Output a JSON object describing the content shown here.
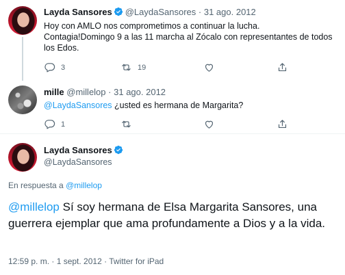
{
  "tweet1": {
    "name": "Layda Sansores",
    "handle": "@LaydaSansores",
    "sep": "·",
    "date": "31 ago. 2012",
    "text": "Hoy con AMLO nos comprometimos a continuar la lucha.\nContagia!Domingo 9 a las 11 marcha al Zócalo con representantes de todos los Edos.",
    "replies": "3",
    "retweets": "19",
    "likes": "",
    "icons": [
      "reply-icon",
      "retweet-icon",
      "like-icon",
      "share-icon"
    ]
  },
  "tweet2": {
    "name": "mille",
    "handle": "@millelop",
    "sep": "·",
    "date": "31 ago. 2012",
    "mention": "@LaydaSansores",
    "text": " ¿usted es hermana de Margarita?",
    "replies": "1",
    "retweets": "",
    "likes": ""
  },
  "main": {
    "name": "Layda Sansores",
    "handle": "@LaydaSansores",
    "reply_prefix": "En respuesta a ",
    "reply_mention": "@millelop",
    "mention": "@millelop",
    "text": " Sí soy hermana de Elsa Margarita Sansores, una guerrera ejemplar que ama profundamente a Dios y a la vida.",
    "meta": "12:59 p. m. · 1 sept. 2012 · Twitter for iPad"
  },
  "colors": {
    "accent": "#1d9bf0",
    "muted": "#536471",
    "text": "#0f1419"
  }
}
